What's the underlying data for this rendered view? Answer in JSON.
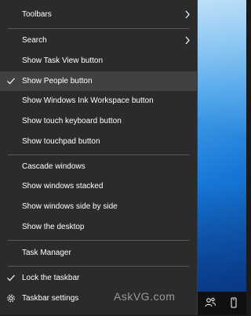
{
  "menu": {
    "items": [
      {
        "label": "Toolbars",
        "submenu": true
      },
      {
        "label": "Search",
        "submenu": true
      },
      {
        "label": "Show Task View button"
      },
      {
        "label": "Show People button",
        "checked": true,
        "highlighted": true
      },
      {
        "label": "Show Windows Ink Workspace button"
      },
      {
        "label": "Show touch keyboard button"
      },
      {
        "label": "Show touchpad button"
      },
      {
        "label": "Cascade windows"
      },
      {
        "label": "Show windows stacked"
      },
      {
        "label": "Show windows side by side"
      },
      {
        "label": "Show the desktop"
      },
      {
        "label": "Task Manager"
      },
      {
        "label": "Lock the taskbar",
        "checked": true
      },
      {
        "label": "Taskbar settings",
        "icon": "gear-icon"
      }
    ]
  },
  "taskbar": {
    "icons": [
      "people-icon",
      "touch-keyboard-icon"
    ]
  },
  "watermark": "AskVG.com",
  "colors": {
    "menu_bg": "#2b2b2b",
    "highlight": "#414141",
    "separator": "#5a5a5a",
    "text": "#ffffff",
    "taskbar": "#101010",
    "desktop_blue": "#1677d6"
  }
}
